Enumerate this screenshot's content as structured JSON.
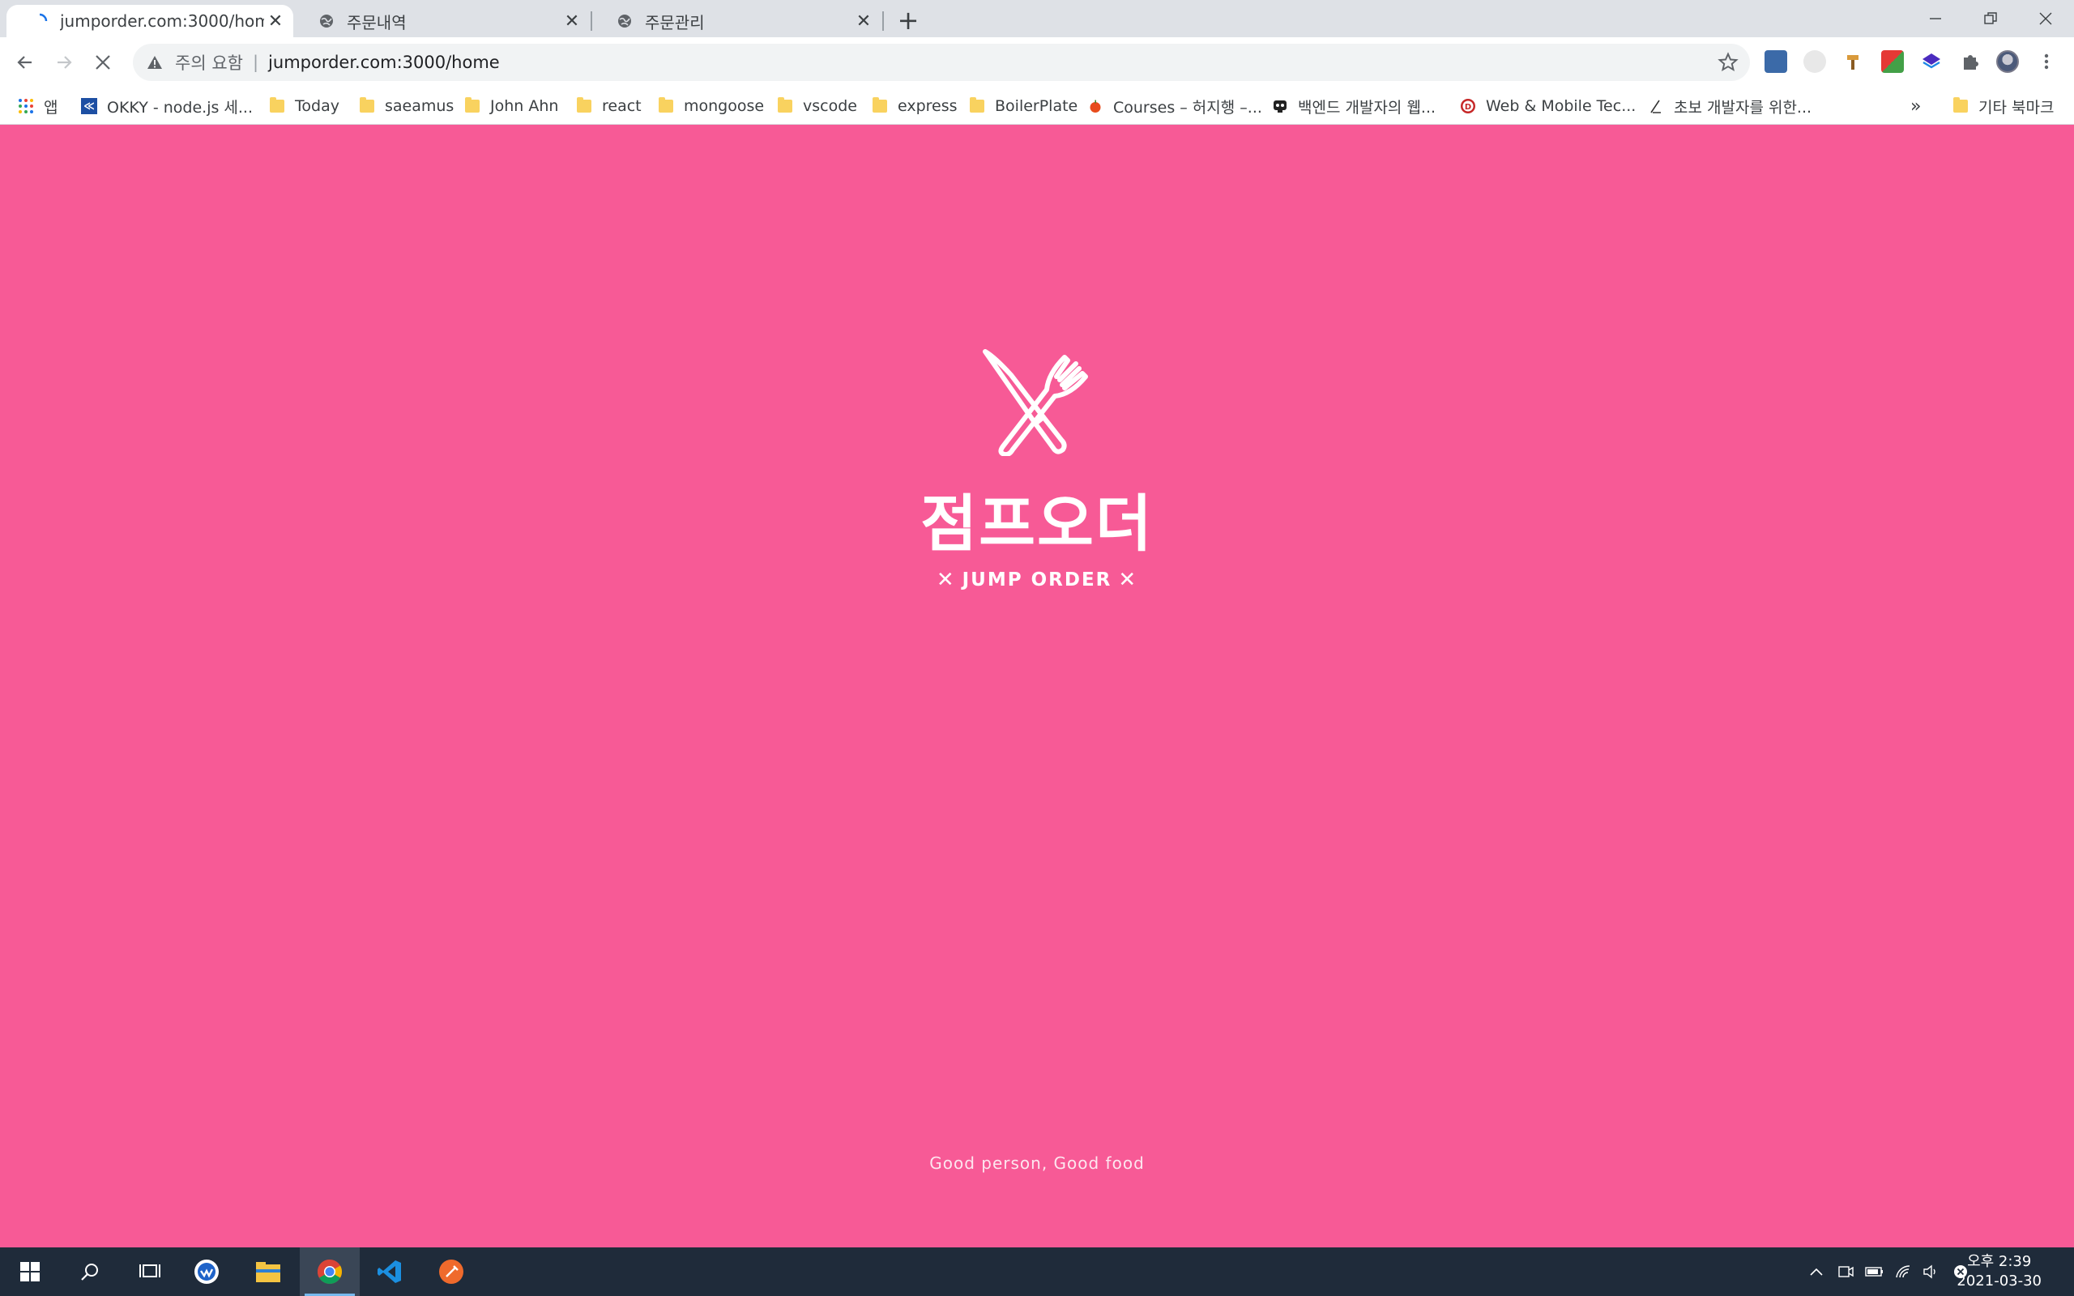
{
  "tabs": [
    {
      "title": "jumporder.com:3000/home",
      "active": true
    },
    {
      "title": "주문내역",
      "active": false
    },
    {
      "title": "주문관리",
      "active": false
    }
  ],
  "address_bar": {
    "security_warning": "주의 요함",
    "url": "jumporder.com:3000/home"
  },
  "bookmarks": {
    "apps_label": "앱",
    "items": [
      {
        "label": "OKKY - node.js 세...",
        "icon": "okky-icon"
      },
      {
        "label": "Today",
        "icon": "folder-icon"
      },
      {
        "label": "saeamus",
        "icon": "folder-icon"
      },
      {
        "label": "John Ahn",
        "icon": "folder-icon"
      },
      {
        "label": "react",
        "icon": "folder-icon"
      },
      {
        "label": "mongoose",
        "icon": "folder-icon"
      },
      {
        "label": "vscode",
        "icon": "folder-icon"
      },
      {
        "label": "express",
        "icon": "folder-icon"
      },
      {
        "label": "BoilerPlate",
        "icon": "folder-icon"
      },
      {
        "label": "Courses – 허지행 –...",
        "icon": "apple-icon"
      },
      {
        "label": "백엔드 개발자의 웹...",
        "icon": "dev-icon"
      },
      {
        "label": "Web & Mobile Tec...",
        "icon": "fc-icon"
      },
      {
        "label": "초보 개발자를 위한...",
        "icon": "pen-icon"
      }
    ],
    "overflow": "»",
    "other_label": "기타 북마크"
  },
  "page": {
    "brand_korean": "점프오더",
    "brand_english": "JUMP ORDER",
    "brand_symbol": "✕",
    "slogan": "Good person, Good food",
    "background": "#f75a96",
    "text_color": "#ffffff"
  },
  "taskbar": {
    "clock_time": "오후 2:39",
    "clock_date": "2021-03-30"
  }
}
